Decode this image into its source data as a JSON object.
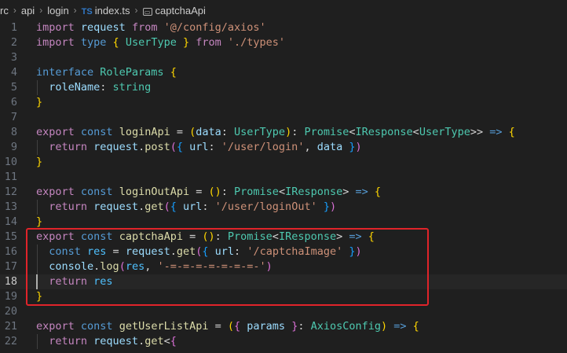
{
  "breadcrumb": {
    "segments": [
      "rc",
      "api",
      "login"
    ],
    "file_icon": "TS",
    "file": "index.ts",
    "symbol_icon": "symbol-variable-icon",
    "symbol": "captchaApi"
  },
  "editor": {
    "active_line": 18,
    "highlight_lines": [
      15,
      19
    ],
    "lines": [
      {
        "n": "1",
        "tokens": [
          [
            "import ",
            "kw2"
          ],
          [
            "request ",
            "var"
          ],
          [
            "from ",
            "kw2"
          ],
          [
            "'@/config/axios'",
            "str"
          ]
        ]
      },
      {
        "n": "2",
        "tokens": [
          [
            "import ",
            "kw2"
          ],
          [
            "type ",
            "kw"
          ],
          [
            "{ ",
            "b1"
          ],
          [
            "UserType ",
            "ty"
          ],
          [
            "} ",
            "b1"
          ],
          [
            "from ",
            "kw2"
          ],
          [
            "'./types'",
            "str"
          ]
        ]
      },
      {
        "n": "3",
        "tokens": []
      },
      {
        "n": "4",
        "tokens": [
          [
            "interface ",
            "kw"
          ],
          [
            "RoleParams ",
            "ty"
          ],
          [
            "{",
            "b1"
          ]
        ]
      },
      {
        "n": "5",
        "tokens": [
          [
            "  roleName",
            "var"
          ],
          [
            ": ",
            "pu"
          ],
          [
            "string",
            "ty"
          ]
        ]
      },
      {
        "n": "6",
        "tokens": [
          [
            "}",
            "b1"
          ]
        ]
      },
      {
        "n": "7",
        "tokens": []
      },
      {
        "n": "8",
        "tokens": [
          [
            "export ",
            "kw2"
          ],
          [
            "const ",
            "kw"
          ],
          [
            "loginApi ",
            "fn"
          ],
          [
            "= ",
            "pu"
          ],
          [
            "(",
            "b1"
          ],
          [
            "data",
            "var"
          ],
          [
            ": ",
            "pu"
          ],
          [
            "UserType",
            "ty"
          ],
          [
            ")",
            "b1"
          ],
          [
            ": ",
            "pu"
          ],
          [
            "Promise",
            "ty"
          ],
          [
            "<",
            "pu"
          ],
          [
            "IResponse",
            "ty"
          ],
          [
            "<",
            "pu"
          ],
          [
            "UserType",
            "ty"
          ],
          [
            ">> ",
            "pu"
          ],
          [
            "=> ",
            "kw"
          ],
          [
            "{",
            "b1"
          ]
        ]
      },
      {
        "n": "9",
        "tokens": [
          [
            "  return ",
            "kw2"
          ],
          [
            "request",
            "var"
          ],
          [
            ".",
            "pu"
          ],
          [
            "post",
            "fn"
          ],
          [
            "(",
            "b2"
          ],
          [
            "{ ",
            "b3"
          ],
          [
            "url",
            "var"
          ],
          [
            ": ",
            "pu"
          ],
          [
            "'/user/login'",
            "str"
          ],
          [
            ", ",
            "pu"
          ],
          [
            "data ",
            "var"
          ],
          [
            "}",
            "b3"
          ],
          [
            ")",
            "b2"
          ]
        ]
      },
      {
        "n": "10",
        "tokens": [
          [
            "}",
            "b1"
          ]
        ]
      },
      {
        "n": "11",
        "tokens": []
      },
      {
        "n": "12",
        "tokens": [
          [
            "export ",
            "kw2"
          ],
          [
            "const ",
            "kw"
          ],
          [
            "loginOutApi ",
            "fn"
          ],
          [
            "= ",
            "pu"
          ],
          [
            "()",
            "b1"
          ],
          [
            ": ",
            "pu"
          ],
          [
            "Promise",
            "ty"
          ],
          [
            "<",
            "pu"
          ],
          [
            "IResponse",
            "ty"
          ],
          [
            "> ",
            "pu"
          ],
          [
            "=> ",
            "kw"
          ],
          [
            "{",
            "b1"
          ]
        ]
      },
      {
        "n": "13",
        "tokens": [
          [
            "  return ",
            "kw2"
          ],
          [
            "request",
            "var"
          ],
          [
            ".",
            "pu"
          ],
          [
            "get",
            "fn"
          ],
          [
            "(",
            "b2"
          ],
          [
            "{ ",
            "b3"
          ],
          [
            "url",
            "var"
          ],
          [
            ": ",
            "pu"
          ],
          [
            "'/user/loginOut' ",
            "str"
          ],
          [
            "}",
            "b3"
          ],
          [
            ")",
            "b2"
          ]
        ]
      },
      {
        "n": "14",
        "tokens": [
          [
            "}",
            "b1"
          ]
        ]
      },
      {
        "n": "15",
        "tokens": [
          [
            "export ",
            "kw2"
          ],
          [
            "const ",
            "kw"
          ],
          [
            "captchaApi ",
            "fn"
          ],
          [
            "= ",
            "pu"
          ],
          [
            "()",
            "b1"
          ],
          [
            ": ",
            "pu"
          ],
          [
            "Promise",
            "ty"
          ],
          [
            "<",
            "pu"
          ],
          [
            "IResponse",
            "ty"
          ],
          [
            "> ",
            "pu"
          ],
          [
            "=> ",
            "kw"
          ],
          [
            "{",
            "b1"
          ]
        ]
      },
      {
        "n": "16",
        "tokens": [
          [
            "  const ",
            "kw"
          ],
          [
            "res ",
            "cn"
          ],
          [
            "= ",
            "pu"
          ],
          [
            "request",
            "var"
          ],
          [
            ".",
            "pu"
          ],
          [
            "get",
            "fn"
          ],
          [
            "(",
            "b2"
          ],
          [
            "{ ",
            "b3"
          ],
          [
            "url",
            "var"
          ],
          [
            ": ",
            "pu"
          ],
          [
            "'/captchaImage' ",
            "str"
          ],
          [
            "}",
            "b3"
          ],
          [
            ")",
            "b2"
          ]
        ]
      },
      {
        "n": "17",
        "tokens": [
          [
            "  console",
            "var"
          ],
          [
            ".",
            "pu"
          ],
          [
            "log",
            "fn"
          ],
          [
            "(",
            "b2"
          ],
          [
            "res",
            "cn"
          ],
          [
            ", ",
            "pu"
          ],
          [
            "'-=-=-=-=-=-=-=-'",
            "str"
          ],
          [
            ")",
            "b2"
          ]
        ]
      },
      {
        "n": "18",
        "tokens": [
          [
            "  return ",
            "kw2"
          ],
          [
            "res",
            "cn"
          ]
        ]
      },
      {
        "n": "19",
        "tokens": [
          [
            "}",
            "b1"
          ]
        ]
      },
      {
        "n": "20",
        "tokens": []
      },
      {
        "n": "21",
        "tokens": [
          [
            "export ",
            "kw2"
          ],
          [
            "const ",
            "kw"
          ],
          [
            "getUserListApi ",
            "fn"
          ],
          [
            "= ",
            "pu"
          ],
          [
            "(",
            "b1"
          ],
          [
            "{ ",
            "b2"
          ],
          [
            "params ",
            "var"
          ],
          [
            "}",
            "b2"
          ],
          [
            ": ",
            "pu"
          ],
          [
            "AxiosConfig",
            "ty"
          ],
          [
            ") ",
            "b1"
          ],
          [
            "=> ",
            "kw"
          ],
          [
            "{",
            "b1"
          ]
        ]
      },
      {
        "n": "22",
        "tokens": [
          [
            "  return ",
            "kw2"
          ],
          [
            "request",
            "var"
          ],
          [
            ".",
            "pu"
          ],
          [
            "get",
            "fn"
          ],
          [
            "<",
            "pu"
          ],
          [
            "{",
            "b2"
          ]
        ]
      }
    ]
  }
}
